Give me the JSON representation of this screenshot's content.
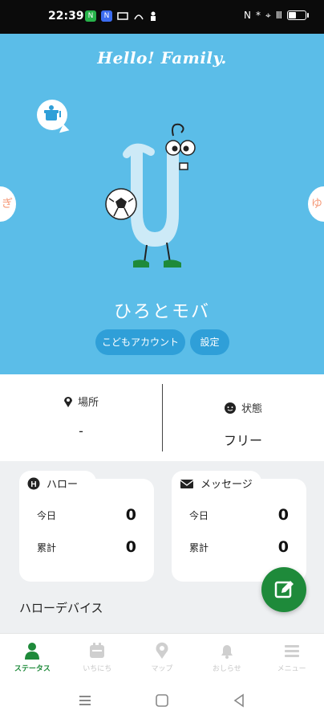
{
  "status_bar": {
    "time": "22:39",
    "left_apps": [
      {
        "icon": "app-line-icon",
        "color": "#27b34a",
        "text": "N"
      },
      {
        "icon": "app-blue-icon",
        "color": "#3b6cf0",
        "text": "N"
      }
    ],
    "right_glyphs": [
      "N",
      "*",
      "⌖",
      "Ⅲ"
    ],
    "battery_percent": 0.45
  },
  "hero": {
    "brand": "Hello! Family.",
    "left_side_letter": "ぎ",
    "right_side_letter": "ゆ",
    "child_name": "ひろとモバ",
    "kids_account_button": "こどもアカウント",
    "settings_button": "設定",
    "background_color": "#5bbde8"
  },
  "info": {
    "location_label": "場所",
    "location_value": "-",
    "status_label": "状態",
    "status_value": "フリー"
  },
  "cards": {
    "hello": {
      "title": "ハロー",
      "today_label": "今日",
      "today_value": "0",
      "total_label": "累計",
      "total_value": "0"
    },
    "message": {
      "title": "メッセージ",
      "today_label": "今日",
      "today_value": "0",
      "total_label": "累計",
      "total_value": "0"
    },
    "devices_heading": "ハローデバイス"
  },
  "bottom_nav": {
    "items": [
      {
        "label": "ステータス",
        "icon": "person-icon",
        "active": true
      },
      {
        "label": "いちにち",
        "icon": "calendar-icon",
        "active": false
      },
      {
        "label": "マップ",
        "icon": "map-pin-icon",
        "active": false
      },
      {
        "label": "おしらせ",
        "icon": "bell-icon",
        "active": false
      },
      {
        "label": "メニュー",
        "icon": "menu-icon",
        "active": false
      }
    ]
  },
  "colors": {
    "accent_green": "#1e8a3a",
    "hero_blue": "#5bbde8",
    "pill_blue": "#2f9fd8"
  }
}
